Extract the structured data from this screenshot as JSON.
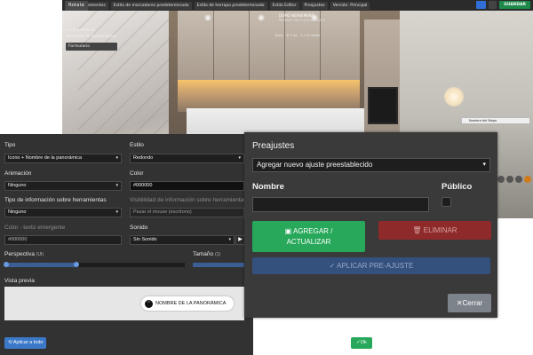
{
  "toolbar": {
    "items": [
      "Lista de elementos",
      "Rotate",
      "Estilo de marcadores predeterminado",
      "Estilo de herrapo predeterminado",
      "Estilo Editor",
      "Preajustes",
      "Versión: Principal"
    ],
    "save_label": "GUARDAR"
  },
  "scene": {
    "title": "DOMO NEAREMENTI",
    "subtitle": "Nombre de la panorámica",
    "meta": "Área  ◦  ♦ 3 ud  ◦  1 / 10 Vistas",
    "left_lines": [
      "Ir a la animación",
      "Animación de la panorámica"
    ],
    "left_select": "Formulario",
    "mini_window": "Nombre del Mapa"
  },
  "props": {
    "tipo_label": "Tipo",
    "tipo_value": "Icono + Nombre de la panorámica",
    "estilo_label": "Estilo",
    "estilo_value": "Redondo",
    "animacion_label": "Animación",
    "animacion_value": "Ninguno",
    "color_label": "Color",
    "color_value": "#000000",
    "tipo_info_label": "Tipo de información sobre herramientas",
    "tipo_info_value": "Ninguno",
    "visibilidad_label": "Visibilidad de información sobre herramientas",
    "visibilidad_value": "Pasar el mouse (escritorio)",
    "color_texto_label": "Color - texto emergente",
    "color_texto_value": "#000000",
    "sonido_label": "Sonido",
    "sonido_value": "Sin Sonido",
    "perspectiva_label": "Perspectiva",
    "perspectiva_unit": "(UI)",
    "perspectiva_level": 0.4,
    "tamano_label": "Tamaño",
    "tamano_unit": "(1)",
    "vista_previa_label": "Vista previa",
    "preview_chip_text": "NOMBRE DE LA PANORÁMICA",
    "apply_all_label": "Aplicar a todo",
    "ok_label": "Ok"
  },
  "dialog": {
    "title": "Preajustes",
    "select_value": "Agregar nuevo ajuste preestablecido",
    "name_label": "Nombre",
    "public_label": "Público",
    "add_label_1": "AGREGAR /",
    "add_label_2": "ACTUALIZAR",
    "delete_label": "ELIMINAR",
    "apply_label": "APLICAR PRE-AJUSTE",
    "close_label": "Cerrar"
  },
  "colors": {
    "accent_green": "#27a85a",
    "accent_red": "#8f2a2a",
    "accent_blue": "#3c78c8"
  }
}
